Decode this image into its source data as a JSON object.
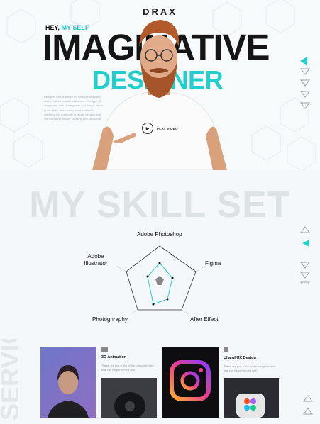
{
  "header": {
    "logo": "DRAX"
  },
  "hero": {
    "greeting": "HEY,",
    "greeting_accent": "MY SELF",
    "title_line1": "IMAGINATIVE",
    "title_line2": "DESIGNER",
    "description": "Designer who is known for their creativity and ability to think outside of the box. This type of designer is able to bring new and unique ideas to the table, often using unconventional methods and materials to create designs that are both aesthetically pleasing and functional.",
    "play_label": "PLAY VIDEO"
  },
  "skills": {
    "heading": "MY SKILL SET",
    "labels": {
      "photoshop": "Adobe Photoshop",
      "figma": "Figma",
      "aftereffect": "After Effect",
      "photography": "Photoghraphy",
      "illustrator_line1": "Adobe",
      "illustrator_line2": "Illustrator"
    }
  },
  "services": {
    "heading": "SERVICES",
    "card1": {
      "title": "3D Animation",
      "desc": "These are just a few of the many services that can be performed with"
    },
    "card2": {
      "title": "UI and UX Design",
      "desc": "These are just a few of the many services that can be performed with"
    }
  },
  "colors": {
    "accent": "#21d0cd",
    "dark": "#151515"
  }
}
